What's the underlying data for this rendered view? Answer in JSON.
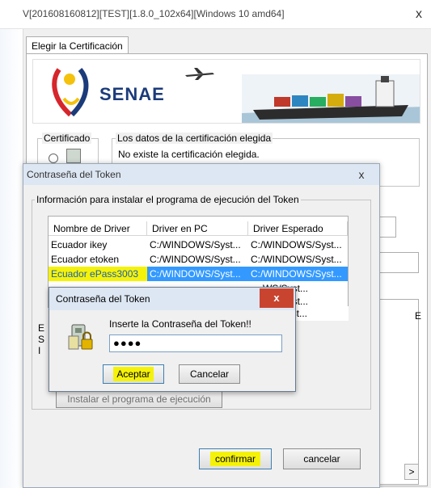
{
  "main_window": {
    "title": "V[201608160812][TEST][1.8.0_102x64][Windows 10 amd64]",
    "close_glyph": "x",
    "tab_label": "Elegir la Certificación",
    "brand": "SENAE",
    "certificado_label": "Certificado",
    "datos_group_label": "Los datos de la certificación elegida",
    "datos_status": "No existe la certificación elegida.",
    "confirm_label": "confirmar",
    "cancel_label": "cancelar",
    "scroll_right_glyph": ">",
    "partial_letter": "E"
  },
  "token_dialog": {
    "title": "Contraseña del Token",
    "close_glyph": "x",
    "group_label": "Información para instalar el programa de ejecución del Token",
    "table": {
      "headers": [
        "Nombre de Driver",
        "Driver en PC",
        "Driver Esperado"
      ],
      "rows": [
        [
          "Ecuador ikey",
          "C:/WINDOWS/Syst...",
          "C:/WINDOWS/Syst..."
        ],
        [
          "Ecuador etoken",
          "C:/WINDOWS/Syst...",
          "C:/WINDOWS/Syst..."
        ],
        [
          "Ecuador ePass3003",
          "C:/WINDOWS/Syst...",
          "C:/WINDOWS/Syst..."
        ],
        [
          "",
          "",
          "WS/Syst..."
        ],
        [
          "",
          "",
          "WS/Syst..."
        ],
        [
          "",
          "",
          "WS/Syst..."
        ]
      ],
      "selected_row_index": 2
    },
    "install_button_label": "Instalar el programa de ejecución",
    "partial_letters": [
      "E",
      "S",
      "I"
    ]
  },
  "password_dialog": {
    "title": "Contraseña del Token",
    "close_glyph": "x",
    "prompt": "Inserte la Contraseña del Token!!",
    "password_value": "●●●●",
    "ok_label": "Aceptar",
    "cancel_label": "Cancelar",
    "icon_name": "usb-token-lock-icon"
  },
  "colors": {
    "selection": "#3399ff",
    "highlight": "#f5f20a",
    "close_red": "#c9442f",
    "brand_blue": "#1b3b7a",
    "titlebar": "#dde7f3"
  }
}
